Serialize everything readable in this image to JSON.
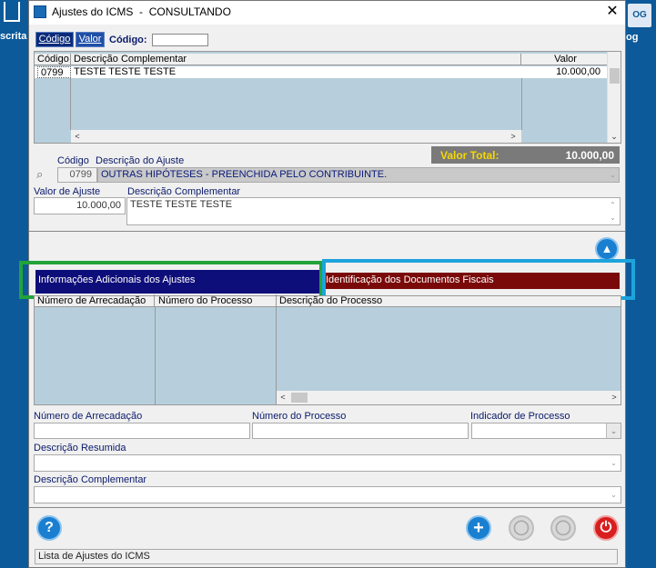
{
  "background": {
    "left_label": "scrita",
    "right_icon_text": "OG",
    "right_label": "og"
  },
  "window": {
    "title": "Ajustes do ICMS  -  CONSULTANDO",
    "close_glyph": "✕"
  },
  "search": {
    "tab_codigo": "Código",
    "tab_valor": "Valor",
    "codigo_label": "Código:",
    "codigo_value": ""
  },
  "grid1": {
    "columns": [
      "Código",
      "Descrição Complementar",
      "Valor"
    ],
    "rows": [
      {
        "codigo": "0799",
        "descricao": "TESTE TESTE TESTE",
        "valor": "10.000,00"
      }
    ]
  },
  "valor_total": {
    "label": "Valor Total:",
    "value": "10.000,00"
  },
  "ajuste": {
    "codigo_label": "Código",
    "descricao_label": "Descrição do Ajuste",
    "codigo_value": "0799",
    "descricao_value": "OUTRAS HIPÓTESES - PREENCHIDA PELO CONTRIBUINTE.",
    "valor_label": "Valor de Ajuste",
    "valor_value": "10.000,00",
    "desc_comp_label": "Descrição Complementar",
    "desc_comp_value": "TESTE TESTE TESTE"
  },
  "tabs2": {
    "info_tab": "Informações Adicionais dos Ajustes",
    "doc_tab": "Identificação dos Documentos Fiscais"
  },
  "grid2": {
    "columns": [
      "Número de Arrecadação",
      "Número do Processo",
      "Descrição do Processo"
    ]
  },
  "form": {
    "num_arrecadacao_label": "Número de Arrecadação",
    "num_processo_label": "Número do Processo",
    "indicador_label": "Indicador de Processo",
    "desc_resumida_label": "Descrição Resumida",
    "desc_complementar_label": "Descrição Complementar"
  },
  "status": "Lista de Ajustes do ICMS",
  "icons": {
    "help": "?",
    "add": "+",
    "up": "▲",
    "power": "⏻"
  }
}
